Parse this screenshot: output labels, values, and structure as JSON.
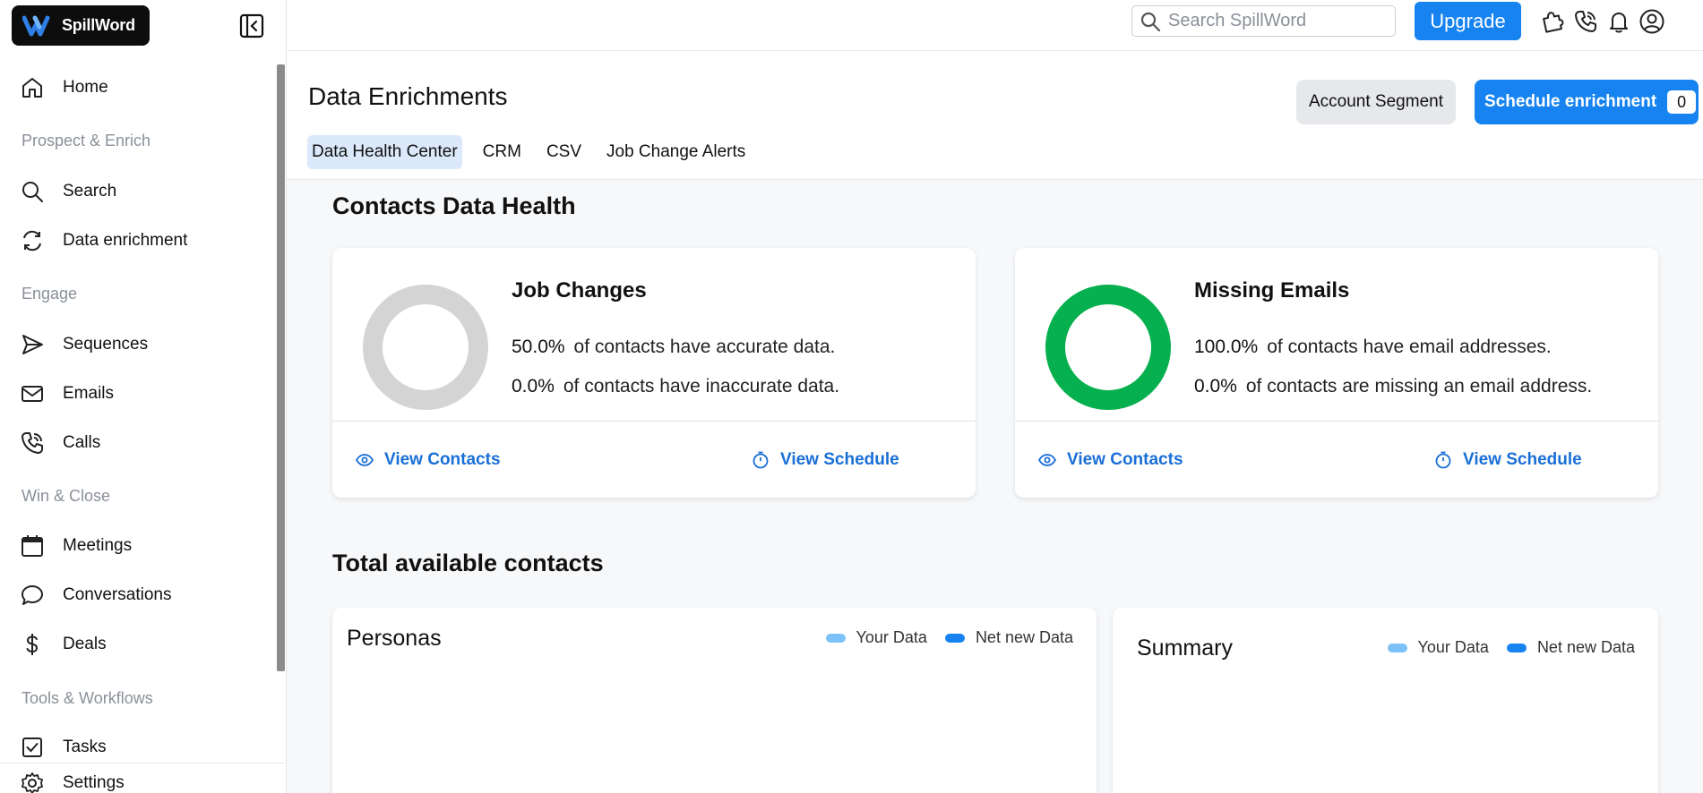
{
  "brand": {
    "name": "SpillWord"
  },
  "sidebar": {
    "items": [
      {
        "label": "Home",
        "icon": "home-icon"
      },
      {
        "group": "Prospect & Enrich"
      },
      {
        "label": "Search",
        "icon": "search-icon"
      },
      {
        "label": "Data enrichment",
        "icon": "refresh-icon"
      },
      {
        "group": "Engage"
      },
      {
        "label": "Sequences",
        "icon": "send-icon"
      },
      {
        "label": "Emails",
        "icon": "mail-icon"
      },
      {
        "label": "Calls",
        "icon": "phone-icon"
      },
      {
        "group": "Win & Close"
      },
      {
        "label": "Meetings",
        "icon": "calendar-icon"
      },
      {
        "label": "Conversations",
        "icon": "chat-icon"
      },
      {
        "label": "Deals",
        "icon": "dollar-icon"
      },
      {
        "group": "Tools & Workflows"
      },
      {
        "label": "Tasks",
        "icon": "checkbox-icon"
      },
      {
        "label": "Settings",
        "icon": "gear-icon"
      }
    ]
  },
  "topbar": {
    "search_placeholder": "Search SpillWord",
    "upgrade_label": "Upgrade",
    "icons": [
      "puzzle-icon",
      "phone-icon",
      "bell-icon",
      "user-icon"
    ]
  },
  "header": {
    "title": "Data Enrichments",
    "account_segment_label": "Account Segment",
    "schedule_label": "Schedule enrichment",
    "schedule_count": "0",
    "tabs": [
      "Data Health Center",
      "CRM",
      "CSV",
      "Job Change Alerts"
    ],
    "active_tab": "Data Health Center"
  },
  "health": {
    "section_title": "Contacts Data Health",
    "cards": [
      {
        "title": "Job Changes",
        "line1_pct": "50.0%",
        "line1_text": "of contacts have accurate data.",
        "line2_pct": "0.0%",
        "line2_text": "of contacts have inaccurate data.",
        "donut_color": "#d4d4d4",
        "view_contacts": "View Contacts",
        "view_schedule": "View Schedule"
      },
      {
        "title": "Missing Emails",
        "line1_pct": "100.0%",
        "line1_text": "of contacts have email addresses.",
        "line2_pct": "0.0%",
        "line2_text": "of contacts are missing an email address.",
        "donut_color": "#07b04f",
        "view_contacts": "View Contacts",
        "view_schedule": "View Schedule"
      }
    ]
  },
  "total": {
    "section_title": "Total available contacts",
    "personas": {
      "title": "Personas",
      "legend_your": "Your Data",
      "legend_new": "Net new Data"
    },
    "summary": {
      "title": "Summary",
      "legend_your": "Your Data",
      "legend_new": "Net new Data"
    },
    "colors": {
      "your_data": "#7cc2f8",
      "net_new": "#1683f0"
    }
  },
  "colors": {
    "accent": "#1683f0",
    "link": "#1a6fd6",
    "active_tab_bg": "#dbe9fb"
  }
}
